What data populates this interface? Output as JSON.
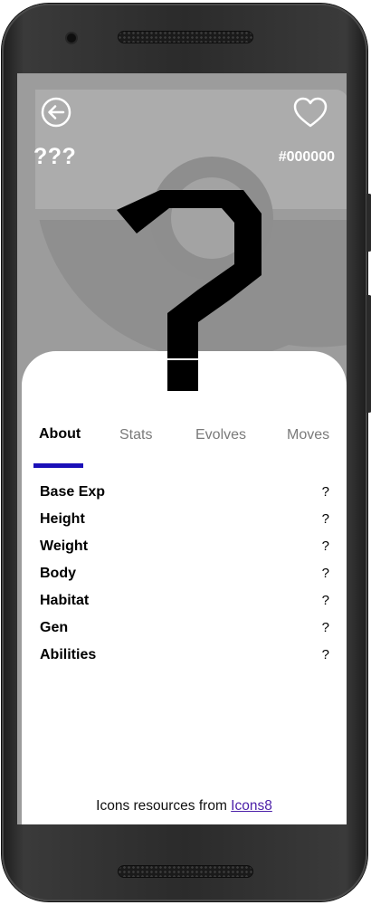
{
  "header": {
    "name": "???",
    "number": "#000000"
  },
  "icons": {
    "back": "back-arrow-icon",
    "favorite": "heart-outline-icon",
    "artwork": "question-mark"
  },
  "tabs": [
    {
      "label": "About",
      "active": true
    },
    {
      "label": "Stats",
      "active": false
    },
    {
      "label": "Evolves",
      "active": false
    },
    {
      "label": "Moves",
      "active": false
    }
  ],
  "about": {
    "rows": [
      {
        "label": "Base Exp",
        "value": "?"
      },
      {
        "label": "Height",
        "value": "?"
      },
      {
        "label": "Weight",
        "value": "?"
      },
      {
        "label": "Body",
        "value": "?"
      },
      {
        "label": "Habitat",
        "value": "?"
      },
      {
        "label": "Gen",
        "value": "?"
      },
      {
        "label": "Abilities",
        "value": "?"
      }
    ]
  },
  "footer": {
    "credit_text": "Icons resources from ",
    "credit_link": "Icons8"
  },
  "colors": {
    "header_bg": "#9c9c9c",
    "tab_indicator": "#1a0fb8",
    "link": "#4b1fa8"
  }
}
